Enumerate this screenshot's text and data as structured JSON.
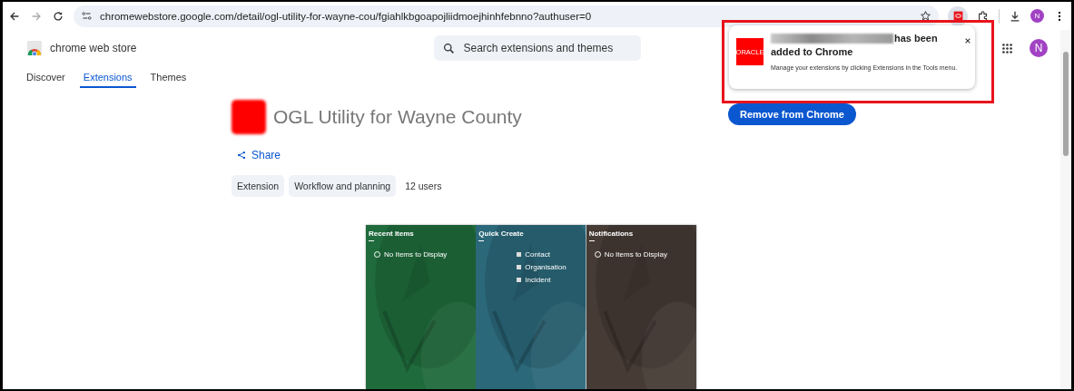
{
  "browser": {
    "url": "chromewebstore.google.com/detail/ogl-utility-for-wayne-cou/fgiahlkbgoapojliidmoejhinhfebnno?authuser=0",
    "profile_initial": "N"
  },
  "store": {
    "brand": "chrome web store",
    "search": {
      "placeholder": "Search extensions and themes"
    },
    "profile_initial": "N",
    "tabs": [
      {
        "label": "Discover",
        "selected": false
      },
      {
        "label": "Extensions",
        "selected": true
      },
      {
        "label": "Themes",
        "selected": false
      }
    ]
  },
  "extension": {
    "title": "OGL Utility for Wayne County",
    "share": "Share",
    "chips": [
      "Extension",
      "Workflow and planning"
    ],
    "users": "12 users",
    "action": "Remove from Chrome"
  },
  "screenshot": {
    "panels": [
      {
        "title": "Recent Items",
        "kind": "empty",
        "empty": "No Items to Display",
        "color": "#1f6b3c"
      },
      {
        "title": "Quick Create",
        "kind": "links",
        "links": [
          "Contact",
          "Organisation",
          "Incident"
        ],
        "color": "#2b687a"
      },
      {
        "title": "Notifications",
        "kind": "empty",
        "empty": "No Items to Display",
        "color": "#463b35"
      }
    ]
  },
  "popup": {
    "logo": "ORACLE",
    "message_tail": "has been",
    "message_line2": "added to Chrome",
    "note": "Manage your extensions by clicking Extensions in the Tools menu.",
    "highlighted": true
  }
}
